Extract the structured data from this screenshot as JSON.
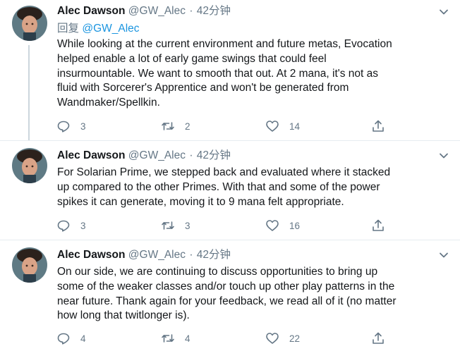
{
  "tweets": [
    {
      "name": "Alec Dawson",
      "handle": "@GW_Alec",
      "dot": "·",
      "time": "42分钟",
      "reply_prefix": "回复",
      "reply_mention": "@GW_Alec",
      "text": "While looking at the current environment and future metas, Evocation\nhelped enable a lot of early game swings that could feel\ninsurmountable. We want to smooth that out. At 2 mana, it's not as\nfluid with Sorcerer's Apprentice and won't be generated from\nWandmaker/Spellkin.",
      "replies": "3",
      "retweets": "2",
      "likes": "14"
    },
    {
      "name": "Alec Dawson",
      "handle": "@GW_Alec",
      "dot": "·",
      "time": "42分钟",
      "text": "For Solarian Prime, we stepped back and evaluated where it stacked\nup compared to the other Primes. With that and some of the power\nspikes it can generate, moving it to 9 mana felt appropriate.",
      "replies": "3",
      "retweets": "3",
      "likes": "16"
    },
    {
      "name": "Alec Dawson",
      "handle": "@GW_Alec",
      "dot": "·",
      "time": "42分钟",
      "text": "On our side, we are continuing to discuss opportunities to bring up\nsome of the weaker classes and/or touch up other play patterns in the\nnear future. Thank again for your feedback, we read all of it (no matter\nhow long that twitlonger is).",
      "replies": "4",
      "retweets": "4",
      "likes": "22"
    }
  ],
  "icons": {
    "reply": "reply-icon",
    "retweet": "retweet-icon",
    "like": "heart-icon",
    "share": "share-icon",
    "more": "chevron-down-icon"
  },
  "colors": {
    "text": "#14171a",
    "secondary": "#657786",
    "link": "#1b95e0",
    "divider": "#e6ecf0",
    "thread_line": "#ccd6dd"
  }
}
